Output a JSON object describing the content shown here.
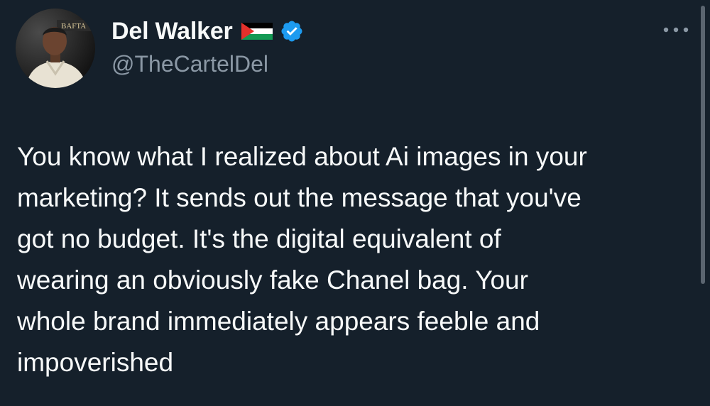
{
  "user": {
    "display_name": "Del Walker",
    "handle": "@TheCartelDel",
    "avatar_badge_text": "BAFTA",
    "flag_icon": "palestine-flag-icon",
    "verified_icon": "verified-badge-icon",
    "verified_color": "#1d9bf0"
  },
  "menu": {
    "icon": "more-options-icon"
  },
  "tweet": {
    "lines": [
      "You know what I realized about Ai images in your",
      "marketing? It sends out the message that you've",
      "got no budget. It's the digital equivalent of",
      "wearing an obviously fake Chanel bag. Your",
      "whole brand immediately appears feeble and",
      "impoverished"
    ]
  },
  "colors": {
    "background": "#15202b",
    "text_primary": "#f7f9f9",
    "text_secondary": "#8b98a5",
    "accent": "#1d9bf0"
  }
}
